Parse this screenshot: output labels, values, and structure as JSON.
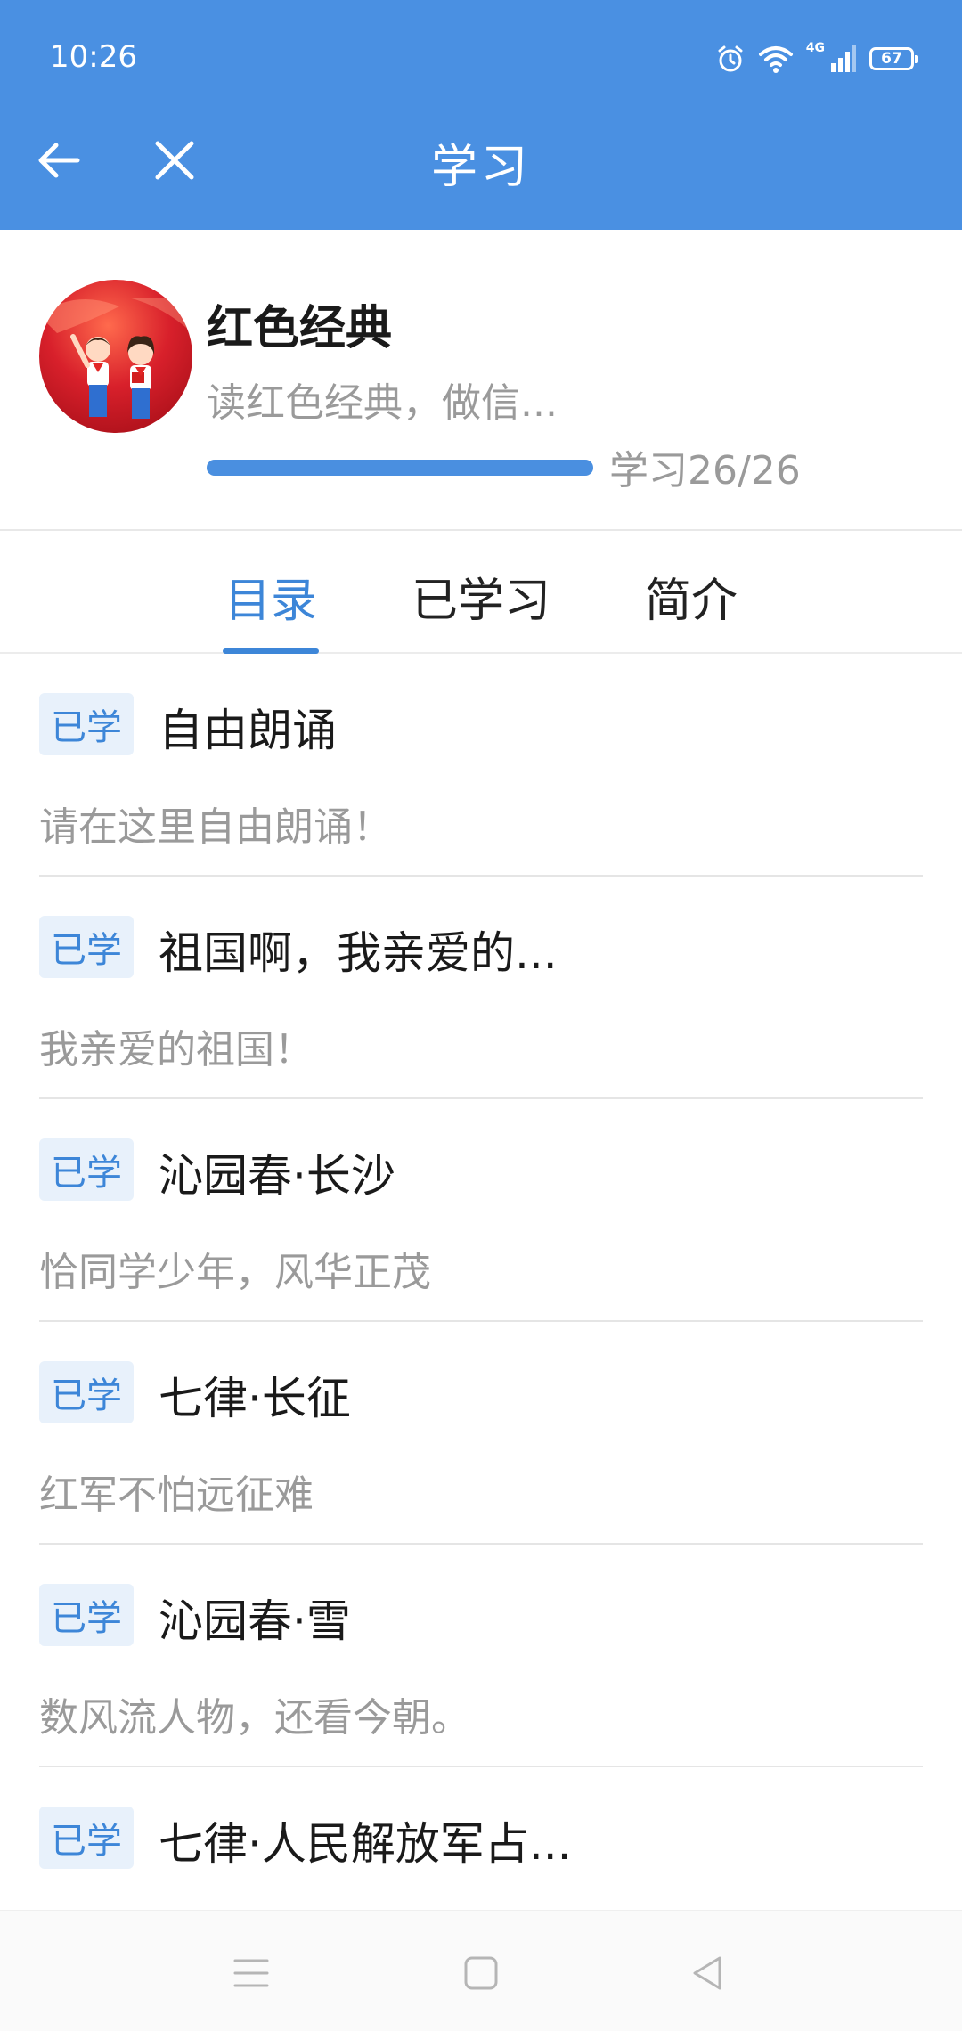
{
  "status_bar": {
    "time": "10:26",
    "battery": "67",
    "network": "4G"
  },
  "nav": {
    "title": "学习",
    "back_icon": "arrow-left-icon",
    "close_icon": "close-icon"
  },
  "course": {
    "title": "红色经典",
    "description": "读红色经典，做信...",
    "progress_text": "学习26/26",
    "progress_fraction": 1.0
  },
  "tabs": [
    {
      "label": "目录",
      "active": true
    },
    {
      "label": "已学习",
      "active": false
    },
    {
      "label": "简介",
      "active": false
    }
  ],
  "items": [
    {
      "badge": "已学",
      "title": "自由朗诵",
      "subtitle": "请在这里自由朗诵！"
    },
    {
      "badge": "已学",
      "title": "祖国啊，我亲爱的...",
      "subtitle": "我亲爱的祖国！"
    },
    {
      "badge": "已学",
      "title": "沁园春·长沙",
      "subtitle": "恰同学少年，风华正茂"
    },
    {
      "badge": "已学",
      "title": "七律·长征",
      "subtitle": "红军不怕远征难"
    },
    {
      "badge": "已学",
      "title": "沁园春·雪",
      "subtitle": "数风流人物，还看今朝。"
    },
    {
      "badge": "已学",
      "title": "七律·人民解放军占...",
      "subtitle": ""
    }
  ],
  "colors": {
    "accent": "#4a90e2",
    "tab_active": "#3d86d8",
    "badge_bg": "#e8f1fb"
  }
}
